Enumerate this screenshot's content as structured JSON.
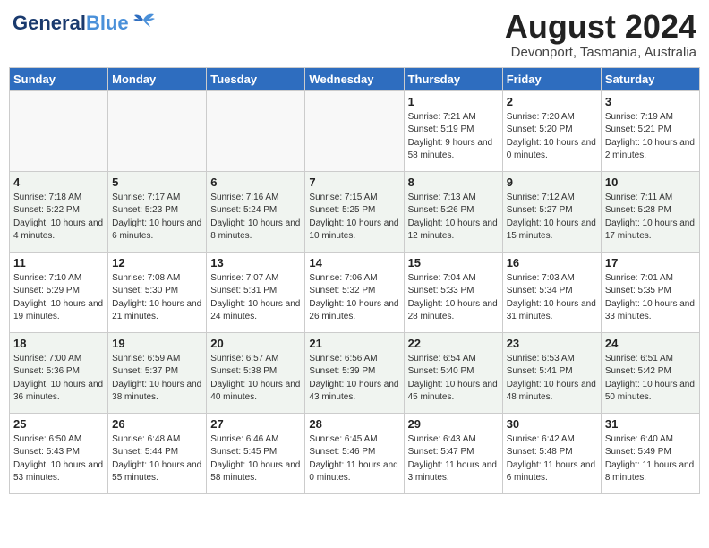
{
  "header": {
    "logo_line1": "General",
    "logo_line2": "Blue",
    "month_year": "August 2024",
    "location": "Devonport, Tasmania, Australia"
  },
  "weekdays": [
    "Sunday",
    "Monday",
    "Tuesday",
    "Wednesday",
    "Thursday",
    "Friday",
    "Saturday"
  ],
  "weeks": [
    [
      {
        "day": "",
        "info": ""
      },
      {
        "day": "",
        "info": ""
      },
      {
        "day": "",
        "info": ""
      },
      {
        "day": "",
        "info": ""
      },
      {
        "day": "1",
        "sunrise": "7:21 AM",
        "sunset": "5:19 PM",
        "daylight": "9 hours and 58 minutes."
      },
      {
        "day": "2",
        "sunrise": "7:20 AM",
        "sunset": "5:20 PM",
        "daylight": "10 hours and 0 minutes."
      },
      {
        "day": "3",
        "sunrise": "7:19 AM",
        "sunset": "5:21 PM",
        "daylight": "10 hours and 2 minutes."
      }
    ],
    [
      {
        "day": "4",
        "sunrise": "7:18 AM",
        "sunset": "5:22 PM",
        "daylight": "10 hours and 4 minutes."
      },
      {
        "day": "5",
        "sunrise": "7:17 AM",
        "sunset": "5:23 PM",
        "daylight": "10 hours and 6 minutes."
      },
      {
        "day": "6",
        "sunrise": "7:16 AM",
        "sunset": "5:24 PM",
        "daylight": "10 hours and 8 minutes."
      },
      {
        "day": "7",
        "sunrise": "7:15 AM",
        "sunset": "5:25 PM",
        "daylight": "10 hours and 10 minutes."
      },
      {
        "day": "8",
        "sunrise": "7:13 AM",
        "sunset": "5:26 PM",
        "daylight": "10 hours and 12 minutes."
      },
      {
        "day": "9",
        "sunrise": "7:12 AM",
        "sunset": "5:27 PM",
        "daylight": "10 hours and 15 minutes."
      },
      {
        "day": "10",
        "sunrise": "7:11 AM",
        "sunset": "5:28 PM",
        "daylight": "10 hours and 17 minutes."
      }
    ],
    [
      {
        "day": "11",
        "sunrise": "7:10 AM",
        "sunset": "5:29 PM",
        "daylight": "10 hours and 19 minutes."
      },
      {
        "day": "12",
        "sunrise": "7:08 AM",
        "sunset": "5:30 PM",
        "daylight": "10 hours and 21 minutes."
      },
      {
        "day": "13",
        "sunrise": "7:07 AM",
        "sunset": "5:31 PM",
        "daylight": "10 hours and 24 minutes."
      },
      {
        "day": "14",
        "sunrise": "7:06 AM",
        "sunset": "5:32 PM",
        "daylight": "10 hours and 26 minutes."
      },
      {
        "day": "15",
        "sunrise": "7:04 AM",
        "sunset": "5:33 PM",
        "daylight": "10 hours and 28 minutes."
      },
      {
        "day": "16",
        "sunrise": "7:03 AM",
        "sunset": "5:34 PM",
        "daylight": "10 hours and 31 minutes."
      },
      {
        "day": "17",
        "sunrise": "7:01 AM",
        "sunset": "5:35 PM",
        "daylight": "10 hours and 33 minutes."
      }
    ],
    [
      {
        "day": "18",
        "sunrise": "7:00 AM",
        "sunset": "5:36 PM",
        "daylight": "10 hours and 36 minutes."
      },
      {
        "day": "19",
        "sunrise": "6:59 AM",
        "sunset": "5:37 PM",
        "daylight": "10 hours and 38 minutes."
      },
      {
        "day": "20",
        "sunrise": "6:57 AM",
        "sunset": "5:38 PM",
        "daylight": "10 hours and 40 minutes."
      },
      {
        "day": "21",
        "sunrise": "6:56 AM",
        "sunset": "5:39 PM",
        "daylight": "10 hours and 43 minutes."
      },
      {
        "day": "22",
        "sunrise": "6:54 AM",
        "sunset": "5:40 PM",
        "daylight": "10 hours and 45 minutes."
      },
      {
        "day": "23",
        "sunrise": "6:53 AM",
        "sunset": "5:41 PM",
        "daylight": "10 hours and 48 minutes."
      },
      {
        "day": "24",
        "sunrise": "6:51 AM",
        "sunset": "5:42 PM",
        "daylight": "10 hours and 50 minutes."
      }
    ],
    [
      {
        "day": "25",
        "sunrise": "6:50 AM",
        "sunset": "5:43 PM",
        "daylight": "10 hours and 53 minutes."
      },
      {
        "day": "26",
        "sunrise": "6:48 AM",
        "sunset": "5:44 PM",
        "daylight": "10 hours and 55 minutes."
      },
      {
        "day": "27",
        "sunrise": "6:46 AM",
        "sunset": "5:45 PM",
        "daylight": "10 hours and 58 minutes."
      },
      {
        "day": "28",
        "sunrise": "6:45 AM",
        "sunset": "5:46 PM",
        "daylight": "11 hours and 0 minutes."
      },
      {
        "day": "29",
        "sunrise": "6:43 AM",
        "sunset": "5:47 PM",
        "daylight": "11 hours and 3 minutes."
      },
      {
        "day": "30",
        "sunrise": "6:42 AM",
        "sunset": "5:48 PM",
        "daylight": "11 hours and 6 minutes."
      },
      {
        "day": "31",
        "sunrise": "6:40 AM",
        "sunset": "5:49 PM",
        "daylight": "11 hours and 8 minutes."
      }
    ]
  ]
}
